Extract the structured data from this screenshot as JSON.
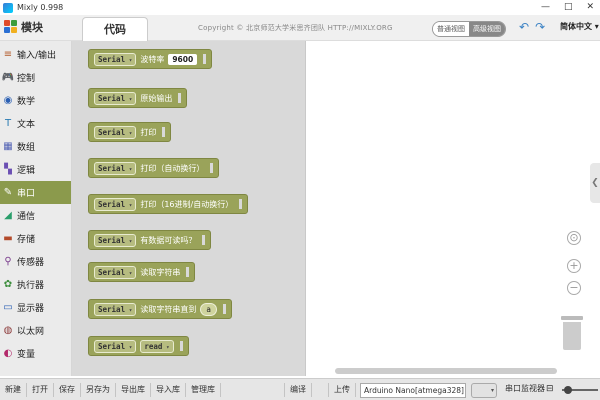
{
  "window": {
    "title": "Mixly 0.998",
    "buttons": [
      "—",
      "□",
      "✕"
    ]
  },
  "header": {
    "logo_label": "模块",
    "code_tab": "代码",
    "copyright": "Copyright © 北京师范大学米思齐团队 HTTP://MIXLY.ORG",
    "view_simple": "普通视图",
    "view_advanced": "高级视图",
    "undo_icon": "undo-icon",
    "redo_icon": "redo-icon",
    "language": "简体中文"
  },
  "sidebar": {
    "items": [
      {
        "label": "输入/输出",
        "icon": "≡",
        "color": "#b35a2a"
      },
      {
        "label": "控制",
        "icon": "🎮",
        "color": "#3c8d3c"
      },
      {
        "label": "数学",
        "icon": "◉",
        "color": "#2a5fb3"
      },
      {
        "label": "文本",
        "icon": "T",
        "color": "#2a7bb3"
      },
      {
        "label": "数组",
        "icon": "▦",
        "color": "#4f5fb3"
      },
      {
        "label": "逻辑",
        "icon": "▚",
        "color": "#6b4fb3"
      },
      {
        "label": "串口",
        "icon": "✎",
        "color": "#ffffff",
        "active": true
      },
      {
        "label": "通信",
        "icon": "◢",
        "color": "#2a9e6b"
      },
      {
        "label": "存储",
        "icon": "▬",
        "color": "#b34a2a"
      },
      {
        "label": "传感器",
        "icon": "⚲",
        "color": "#7a3c8d"
      },
      {
        "label": "执行器",
        "icon": "✿",
        "color": "#3c8d3c"
      },
      {
        "label": "显示器",
        "icon": "▭",
        "color": "#2a5fb3"
      },
      {
        "label": "以太网",
        "icon": "◍",
        "color": "#8d3c3c"
      },
      {
        "label": "变量",
        "icon": "◐",
        "color": "#b32a6b"
      }
    ]
  },
  "flyout": {
    "blocks": [
      {
        "serial": "Serial",
        "text": "波特率",
        "num": "9600"
      },
      {
        "serial": "Serial",
        "text": "原始输出"
      },
      {
        "serial": "Serial",
        "text": "打印"
      },
      {
        "serial": "Serial",
        "text": "打印（自动换行）"
      },
      {
        "serial": "Serial",
        "text": "打印（16进制/自动换行）"
      },
      {
        "serial": "Serial",
        "text": "有数据可读吗？"
      },
      {
        "serial": "Serial",
        "text": "读取字符串"
      },
      {
        "serial": "Serial",
        "text": "读取字符串直到",
        "str": "a"
      },
      {
        "serial": "Serial",
        "text": "",
        "field2": "read"
      }
    ]
  },
  "workspace": {
    "zoom_reset_icon": "⊙",
    "zoom_in_icon": "+",
    "zoom_out_icon": "−",
    "trash_icon": "trash-icon",
    "flyout_toggle": "❮"
  },
  "bottombar": {
    "buttons": [
      "新建",
      "打开",
      "保存",
      "另存为",
      "导出库",
      "导入库",
      "管理库"
    ],
    "compile": "编译",
    "upload": "上传",
    "board": "Arduino Nano[atmega328]",
    "port_placeholder": "▾",
    "monitor": "串口监视器",
    "zoom_icon": "⊟"
  }
}
